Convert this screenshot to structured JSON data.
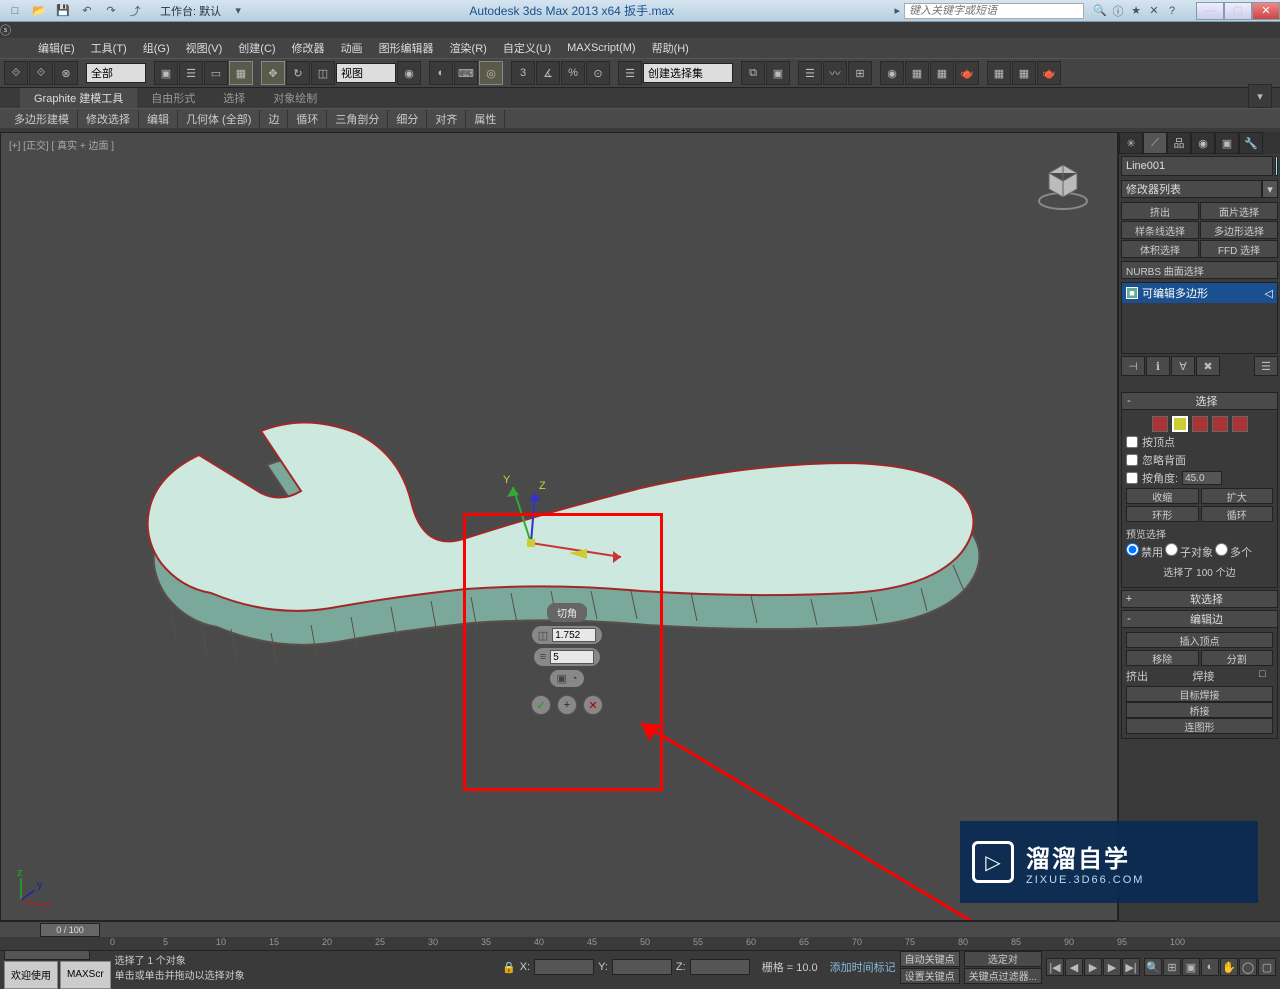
{
  "titleBar": {
    "workspace": "工作台: 默认",
    "appTitle": "Autodesk 3ds Max  2013 x64    扳手.max",
    "searchPlaceholder": "键入关键字或短语"
  },
  "menus": [
    "编辑(E)",
    "工具(T)",
    "组(G)",
    "视图(V)",
    "创建(C)",
    "修改器",
    "动画",
    "图形编辑器",
    "渲染(R)",
    "自定义(U)",
    "MAXScript(M)",
    "帮助(H)"
  ],
  "toolbar": {
    "selFilter": "全部",
    "viewMode": "视图",
    "selSet": "创建选择集"
  },
  "ribbon": {
    "tabs": [
      "Graphite 建模工具",
      "自由形式",
      "选择",
      "对象绘制"
    ],
    "segments": [
      "多边形建模",
      "修改选择",
      "编辑",
      "几何体 (全部)",
      "边",
      "循环",
      "三角剖分",
      "细分",
      "对齐",
      "属性"
    ]
  },
  "viewport": {
    "label": "[+] [正交]  [ 真实 + 边面 ]"
  },
  "caddy": {
    "title": "切角",
    "value1": "1.752",
    "value2": "5"
  },
  "cmdPanel": {
    "objectName": "Line001",
    "modifierList": "修改器列表",
    "grid": [
      "挤出",
      "面片选择",
      "样条线选择",
      "多边形选择",
      "体积选择",
      "FFD 选择"
    ],
    "nurbs": "NURBS 曲面选择",
    "stackItem": "可编辑多边形",
    "selection": {
      "header": "选择",
      "byVertex": "按顶点",
      "ignoreBack": "忽略背面",
      "byAngle": "按角度:",
      "angleVal": "45.0",
      "shrink": "收缩",
      "grow": "扩大",
      "ring": "环形",
      "loop": "循环",
      "previewSel": "预览选择",
      "radioOff": "禁用",
      "radioSub": "子对象",
      "radioMulti": "多个",
      "selInfo": "选择了 100 个边"
    },
    "softSel": "软选择",
    "editEdge": {
      "header": "编辑边",
      "insertVert": "插入顶点",
      "remove": "移除",
      "split": "分割",
      "extrude": "挤出",
      "weld": "焊接",
      "targetWeld": "目标焊接",
      "bridge": "桥接",
      "createShape": "连图形"
    }
  },
  "watermark": {
    "main": "溜溜自学",
    "sub": "ZIXUE.3D66.COM"
  },
  "bottom": {
    "frame": "0 / 100",
    "ticks": [
      0,
      5,
      10,
      15,
      20,
      25,
      30,
      35,
      40,
      45,
      50,
      55,
      60,
      65,
      70,
      75,
      80,
      85,
      90,
      95,
      100
    ],
    "welcome": "欢迎使用",
    "maxscript": "MAXScr",
    "status1": "选择了 1 个对象",
    "status2": "单击或单击并拖动以选择对象",
    "xLabel": "X:",
    "yLabel": "Y:",
    "zLabel": "Z:",
    "grid": "栅格 = 10.0",
    "autoKey": "自动关键点",
    "selKey": "选定对",
    "setKey": "设置关键点",
    "keyFilter": "关键点过滤器...",
    "addTag": "添加时间标记"
  }
}
